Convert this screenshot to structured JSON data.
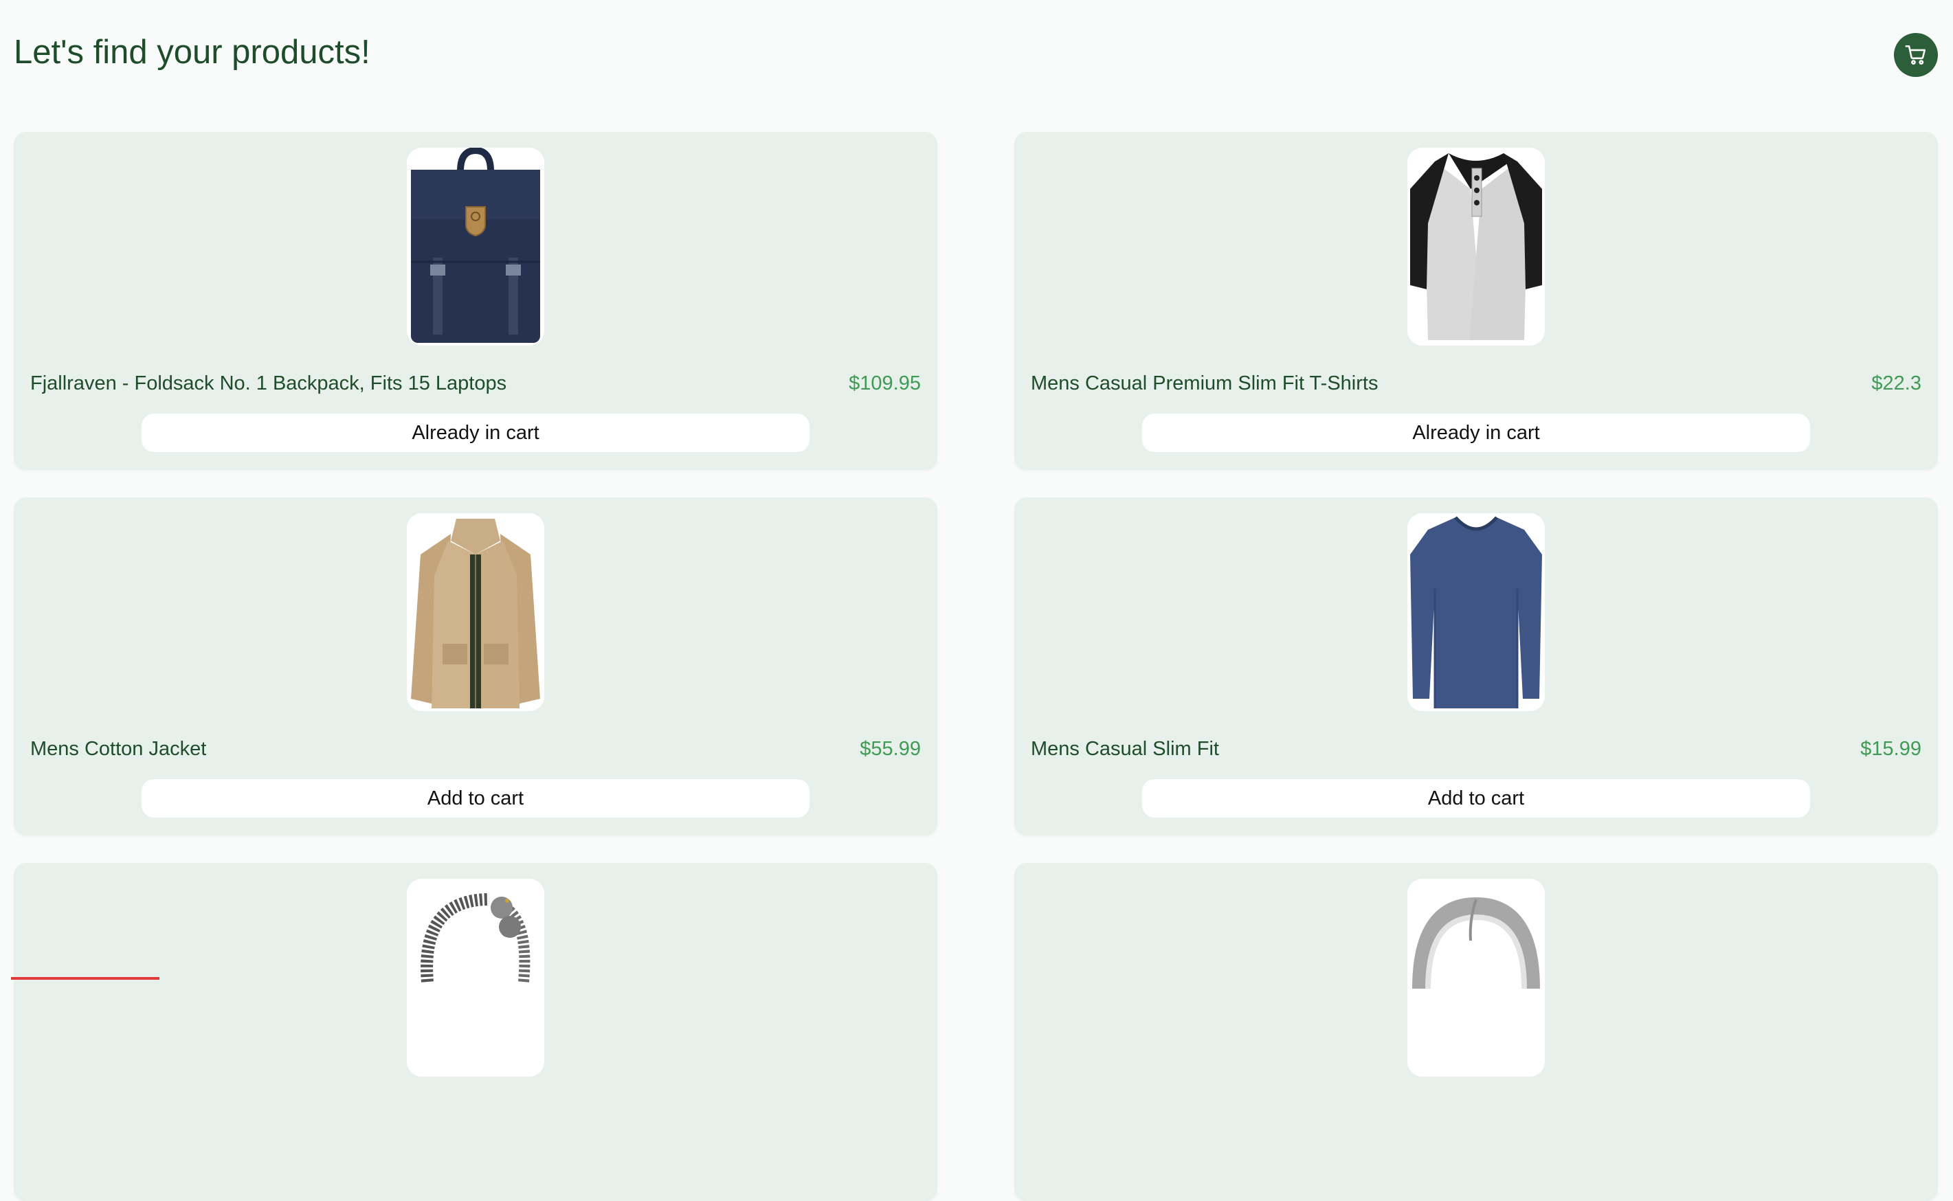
{
  "header": {
    "title": "Let's find your products!",
    "cart_icon": "shopping-cart-icon"
  },
  "products": [
    {
      "title": "Fjallraven - Foldsack No. 1 Backpack, Fits 15 Laptops",
      "price": "$109.95",
      "button": "Already in cart",
      "image": "backpack-image"
    },
    {
      "title": "Mens Casual Premium Slim Fit T-Shirts",
      "price": "$22.3",
      "button": "Already in cart",
      "image": "raglan-shirt-image"
    },
    {
      "title": "Mens Cotton Jacket",
      "price": "$55.99",
      "button": "Add to cart",
      "image": "cotton-jacket-image"
    },
    {
      "title": "Mens Casual Slim Fit",
      "price": "$15.99",
      "button": "Add to cart",
      "image": "long-sleeve-shirt-image"
    },
    {
      "title": "",
      "price": "",
      "button": "",
      "image": "dragon-bracelet-image"
    },
    {
      "title": "",
      "price": "",
      "button": "",
      "image": "silver-ring-image"
    }
  ],
  "colors": {
    "accent": "#2c5e3a",
    "title": "#1f4d2b",
    "price": "#3f9a54",
    "card_bg": "#e7f0eb"
  }
}
